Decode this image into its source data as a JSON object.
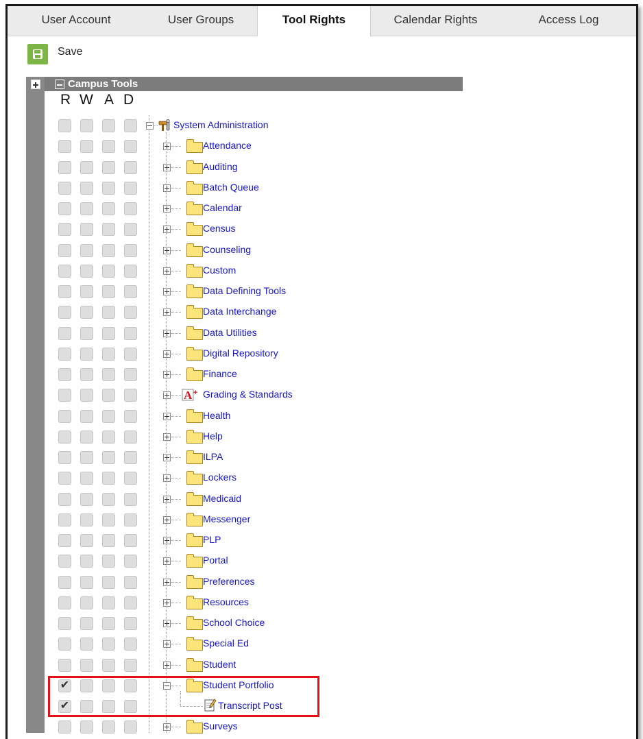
{
  "tabs": [
    {
      "label": "User Account",
      "active": false
    },
    {
      "label": "User Groups",
      "active": false
    },
    {
      "label": "Tool Rights",
      "active": true
    },
    {
      "label": "Calendar Rights",
      "active": false
    },
    {
      "label": "Access Log",
      "active": false
    }
  ],
  "toolbar": {
    "save_label": "Save",
    "save_icon": "floppy-disk-icon"
  },
  "panel": {
    "title": "Campus Tools"
  },
  "permission_columns": [
    "R",
    "W",
    "A",
    "D"
  ],
  "tree": {
    "root": {
      "label": "System Administration",
      "icon": "tools-icon",
      "rights": [
        false,
        false,
        false,
        false
      ],
      "expanded": true
    },
    "children": [
      {
        "label": "Attendance",
        "icon": "folder-icon",
        "rights": [
          false,
          false,
          false,
          false
        ]
      },
      {
        "label": "Auditing",
        "icon": "folder-icon",
        "rights": [
          false,
          false,
          false,
          false
        ]
      },
      {
        "label": "Batch Queue",
        "icon": "folder-icon",
        "rights": [
          false,
          false,
          false,
          false
        ]
      },
      {
        "label": "Calendar",
        "icon": "folder-icon",
        "rights": [
          false,
          false,
          false,
          false
        ]
      },
      {
        "label": "Census",
        "icon": "folder-icon",
        "rights": [
          false,
          false,
          false,
          false
        ]
      },
      {
        "label": "Counseling",
        "icon": "folder-icon",
        "rights": [
          false,
          false,
          false,
          false
        ]
      },
      {
        "label": "Custom",
        "icon": "folder-icon",
        "rights": [
          false,
          false,
          false,
          false
        ]
      },
      {
        "label": "Data Defining Tools",
        "icon": "folder-icon",
        "rights": [
          false,
          false,
          false,
          false
        ]
      },
      {
        "label": "Data Interchange",
        "icon": "folder-icon",
        "rights": [
          false,
          false,
          false,
          false
        ]
      },
      {
        "label": "Data Utilities",
        "icon": "folder-icon",
        "rights": [
          false,
          false,
          false,
          false
        ]
      },
      {
        "label": "Digital Repository",
        "icon": "folder-icon",
        "rights": [
          false,
          false,
          false,
          false
        ]
      },
      {
        "label": "Finance",
        "icon": "folder-icon",
        "rights": [
          false,
          false,
          false,
          false
        ]
      },
      {
        "label": "Grading & Standards",
        "icon": "grading-icon",
        "rights": [
          false,
          false,
          false,
          false
        ]
      },
      {
        "label": "Health",
        "icon": "folder-icon",
        "rights": [
          false,
          false,
          false,
          false
        ]
      },
      {
        "label": "Help",
        "icon": "folder-icon",
        "rights": [
          false,
          false,
          false,
          false
        ]
      },
      {
        "label": "ILPA",
        "icon": "folder-icon",
        "rights": [
          false,
          false,
          false,
          false
        ]
      },
      {
        "label": "Lockers",
        "icon": "folder-icon",
        "rights": [
          false,
          false,
          false,
          false
        ]
      },
      {
        "label": "Medicaid",
        "icon": "folder-icon",
        "rights": [
          false,
          false,
          false,
          false
        ]
      },
      {
        "label": "Messenger",
        "icon": "folder-icon",
        "rights": [
          false,
          false,
          false,
          false
        ]
      },
      {
        "label": "PLP",
        "icon": "folder-icon",
        "rights": [
          false,
          false,
          false,
          false
        ]
      },
      {
        "label": "Portal",
        "icon": "folder-icon",
        "rights": [
          false,
          false,
          false,
          false
        ]
      },
      {
        "label": "Preferences",
        "icon": "folder-icon",
        "rights": [
          false,
          false,
          false,
          false
        ]
      },
      {
        "label": "Resources",
        "icon": "folder-icon",
        "rights": [
          false,
          false,
          false,
          false
        ]
      },
      {
        "label": "School Choice",
        "icon": "folder-icon",
        "rights": [
          false,
          false,
          false,
          false
        ]
      },
      {
        "label": "Special Ed",
        "icon": "folder-icon",
        "rights": [
          false,
          false,
          false,
          false
        ]
      },
      {
        "label": "Student",
        "icon": "folder-icon",
        "rights": [
          false,
          false,
          false,
          false
        ]
      },
      {
        "label": "Student Portfolio",
        "icon": "folder-icon",
        "rights": [
          true,
          false,
          false,
          false
        ],
        "expanded": true,
        "children": [
          {
            "label": "Transcript Post",
            "icon": "transcript-icon",
            "rights": [
              true,
              false,
              false,
              false
            ]
          }
        ]
      },
      {
        "label": "Surveys",
        "icon": "folder-icon",
        "rights": [
          false,
          false,
          false,
          false
        ]
      }
    ]
  },
  "colors": {
    "link": "#1515cc",
    "save_button": "#7db646",
    "header_bar": "#7c7c7c",
    "highlight": "#e3101a"
  }
}
